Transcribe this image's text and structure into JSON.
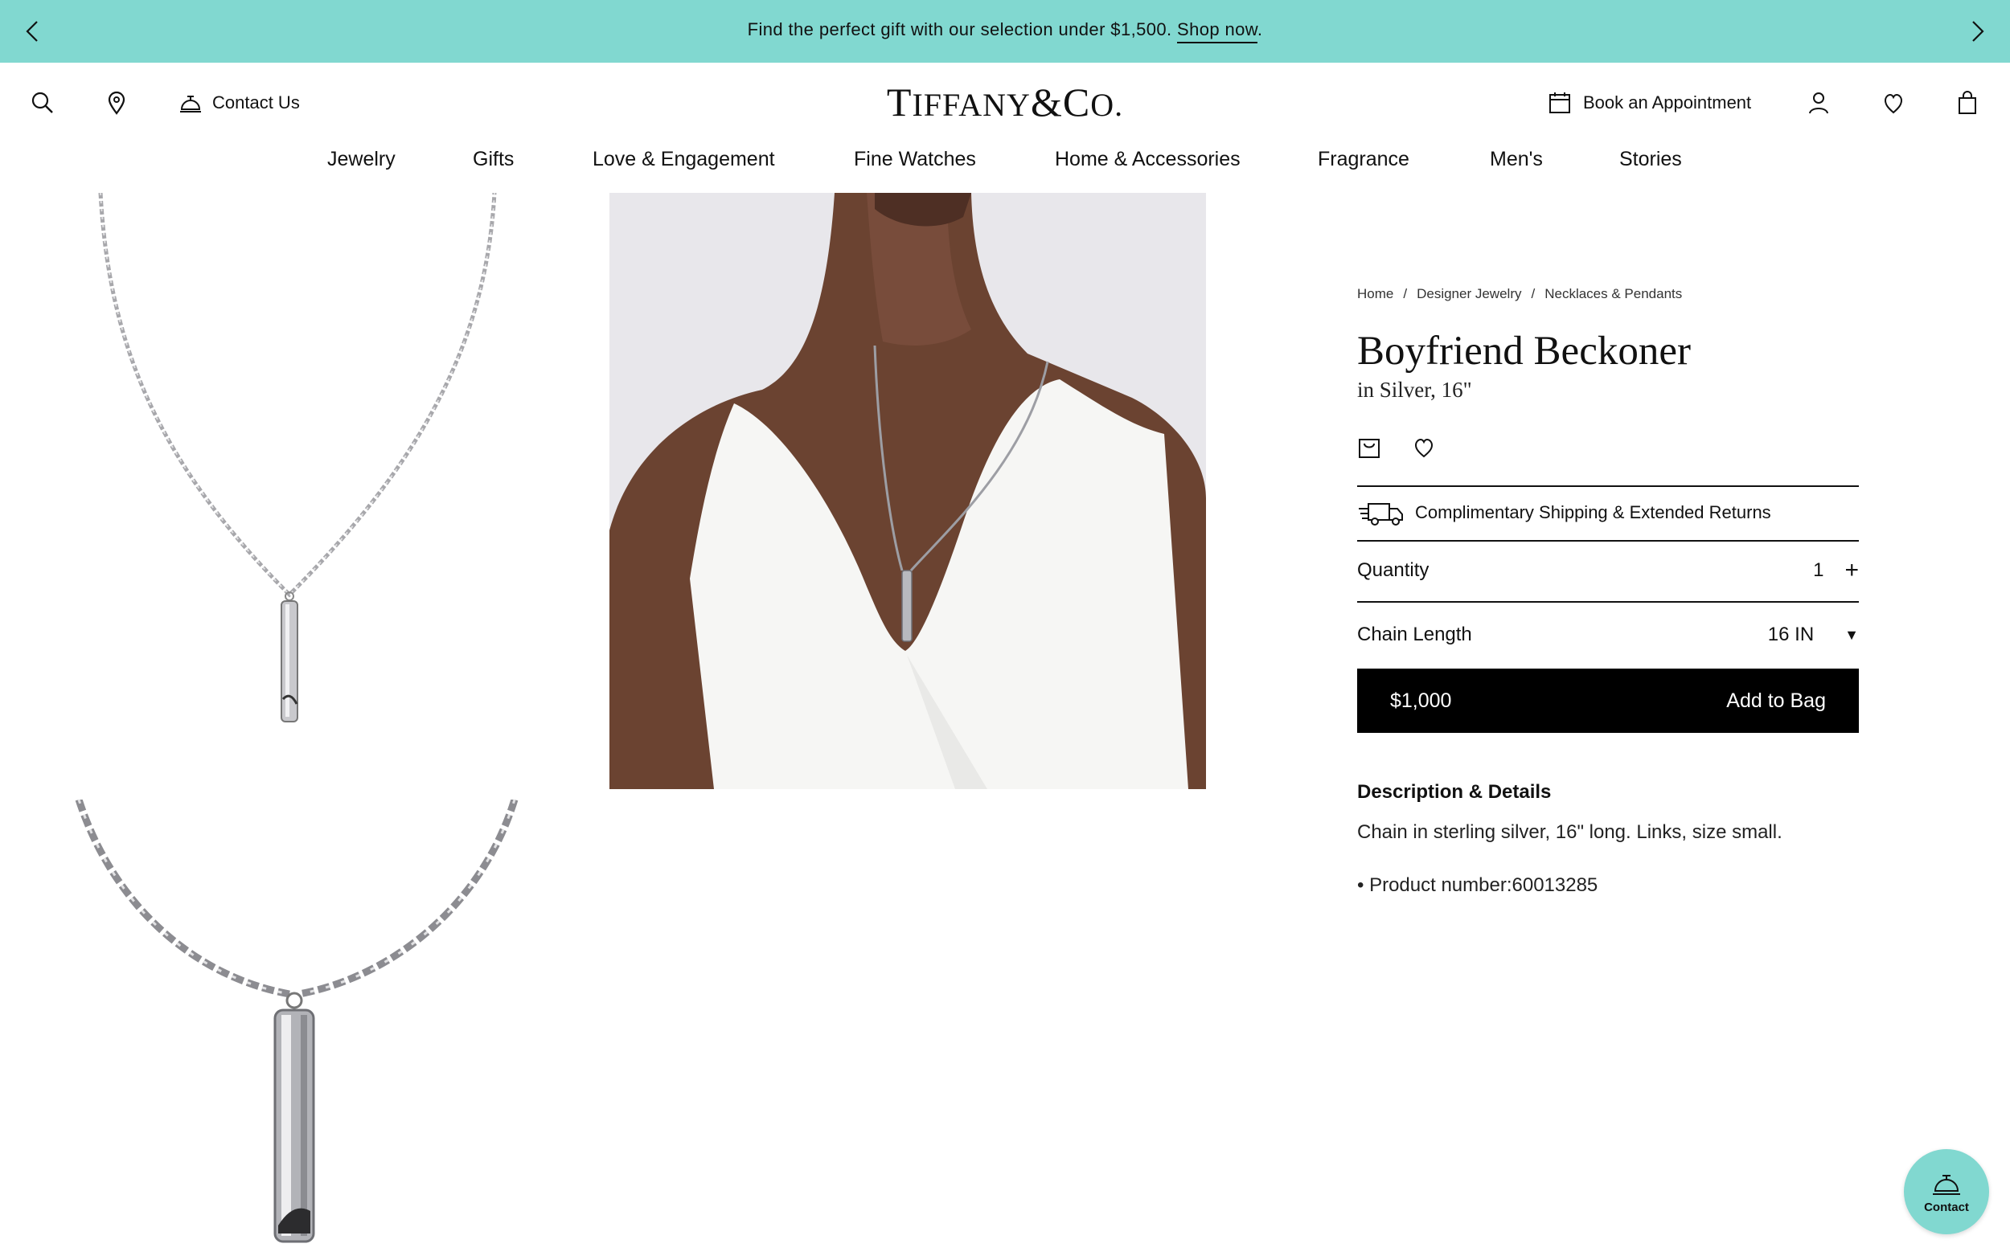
{
  "promo": {
    "message": "Find the perfect gift with our selection under $1,500.",
    "link": "Shop now",
    "suffix": ".",
    "bg_color": "#81d8d0"
  },
  "header": {
    "contact": "Contact Us",
    "logo": {
      "t": "T",
      "iffany": "IFFANY",
      "amp_co": "&C",
      "o": "O."
    },
    "book": "Book an Appointment"
  },
  "nav": [
    "Jewelry",
    "Gifts",
    "Love & Engagement",
    "Fine Watches",
    "Home & Accessories",
    "Fragrance",
    "Men's",
    "Stories"
  ],
  "breadcrumb": [
    "Home",
    "Designer Jewelry",
    "Necklaces & Pendants"
  ],
  "breadcrumb_sep": "/",
  "product": {
    "title": "Boyfriend Beckoner",
    "subtitle": "in Silver, 16\"",
    "shipping": "Complimentary Shipping & Extended Returns",
    "quantity_label": "Quantity",
    "quantity_value": "1",
    "chain_label": "Chain Length",
    "chain_value": "16 IN",
    "price": "$1,000",
    "add_to_bag": "Add to Bag",
    "desc_heading": "Description & Details",
    "desc_text": "Chain in sterling silver, 16\" long. Links, size small.",
    "desc_bullet": "• Product number:60013285"
  },
  "fab": {
    "label": "Contact"
  }
}
